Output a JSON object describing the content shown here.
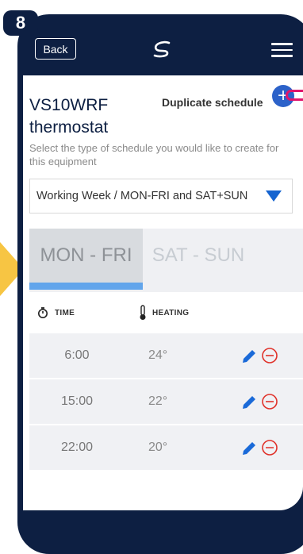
{
  "step_number": "8",
  "header": {
    "back_label": "Back",
    "logo_icon": "swirl-logo-icon",
    "menu_icon": "hamburger-menu-icon"
  },
  "device": {
    "title": "VS10WRF thermostat"
  },
  "duplicate": {
    "label": "Duplicate schedule",
    "button_symbol": "+"
  },
  "schedule_type": {
    "instruction": "Select the type of schedule you would like to create for this equipment",
    "selected": "Working Week / MON-FRI and SAT+SUN"
  },
  "tabs": [
    {
      "label": "MON - FRI",
      "active": true
    },
    {
      "label": "SAT - SUN",
      "active": false
    }
  ],
  "columns": {
    "time": "TIME",
    "heating": "HEATING"
  },
  "rows": [
    {
      "time": "6:00",
      "temp": "24°"
    },
    {
      "time": "15:00",
      "temp": "22°"
    },
    {
      "time": "22:00",
      "temp": "20°"
    }
  ],
  "colors": {
    "header_bg": "#0d1f42",
    "accent_blue": "#1564d0",
    "delete_red": "#e0322a",
    "highlight_pink": "#e0156e",
    "arrow_yellow": "#f7c543"
  }
}
